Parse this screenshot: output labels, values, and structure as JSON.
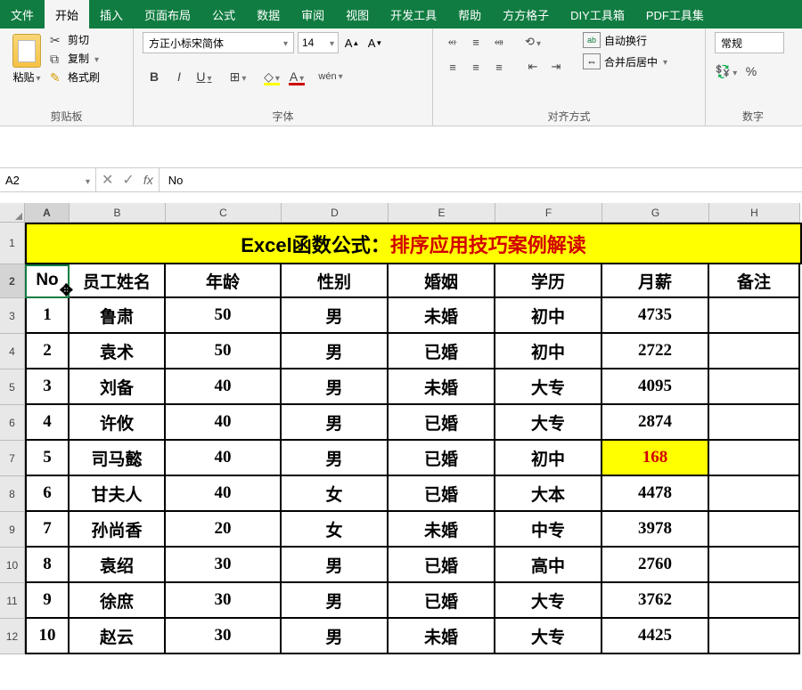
{
  "menu": [
    "文件",
    "开始",
    "插入",
    "页面布局",
    "公式",
    "数据",
    "审阅",
    "视图",
    "开发工具",
    "帮助",
    "方方格子",
    "DIY工具箱",
    "PDF工具集"
  ],
  "menu_active_index": 1,
  "ribbon": {
    "clipboard": {
      "label": "剪贴板",
      "paste": "粘贴",
      "cut": "剪切",
      "copy": "复制",
      "format": "格式刷"
    },
    "font": {
      "label": "字体",
      "name": "方正小标宋简体",
      "size": "14",
      "bold": "B",
      "italic": "I",
      "underline": "U",
      "phonetic": "wén"
    },
    "align": {
      "label": "对齐方式",
      "wrap": "自动换行",
      "merge": "合并后居中"
    },
    "number": {
      "label": "数字",
      "format": "常规",
      "percent": "%"
    }
  },
  "nameBox": "A2",
  "formula": "No",
  "columns": [
    "A",
    "B",
    "C",
    "D",
    "E",
    "F",
    "G",
    "H"
  ],
  "title": {
    "prefix": "Excel函数公式：",
    "suffix": "排序应用技巧案例解读"
  },
  "headers": [
    "No",
    "员工姓名",
    "年龄",
    "性别",
    "婚姻",
    "学历",
    "月薪",
    "备注"
  ],
  "rows": [
    {
      "n": "1",
      "name": "鲁肃",
      "age": "50",
      "sex": "男",
      "mar": "未婚",
      "edu": "初中",
      "sal": "4735",
      "note": ""
    },
    {
      "n": "2",
      "name": "袁术",
      "age": "50",
      "sex": "男",
      "mar": "已婚",
      "edu": "初中",
      "sal": "2722",
      "note": ""
    },
    {
      "n": "3",
      "name": "刘备",
      "age": "40",
      "sex": "男",
      "mar": "未婚",
      "edu": "大专",
      "sal": "4095",
      "note": ""
    },
    {
      "n": "4",
      "name": "许攸",
      "age": "40",
      "sex": "男",
      "mar": "已婚",
      "edu": "大专",
      "sal": "2874",
      "note": ""
    },
    {
      "n": "5",
      "name": "司马懿",
      "age": "40",
      "sex": "男",
      "mar": "已婚",
      "edu": "初中",
      "sal": "168",
      "note": "",
      "hl": true
    },
    {
      "n": "6",
      "name": "甘夫人",
      "age": "40",
      "sex": "女",
      "mar": "已婚",
      "edu": "大本",
      "sal": "4478",
      "note": ""
    },
    {
      "n": "7",
      "name": "孙尚香",
      "age": "20",
      "sex": "女",
      "mar": "未婚",
      "edu": "中专",
      "sal": "3978",
      "note": ""
    },
    {
      "n": "8",
      "name": "袁绍",
      "age": "30",
      "sex": "男",
      "mar": "已婚",
      "edu": "高中",
      "sal": "2760",
      "note": ""
    },
    {
      "n": "9",
      "name": "徐庶",
      "age": "30",
      "sex": "男",
      "mar": "已婚",
      "edu": "大专",
      "sal": "3762",
      "note": ""
    },
    {
      "n": "10",
      "name": "赵云",
      "age": "30",
      "sex": "男",
      "mar": "未婚",
      "edu": "大专",
      "sal": "4425",
      "note": ""
    }
  ],
  "rowNumbers": [
    "1",
    "2",
    "3",
    "4",
    "5",
    "6",
    "7",
    "8",
    "9",
    "10",
    "11",
    "12"
  ]
}
